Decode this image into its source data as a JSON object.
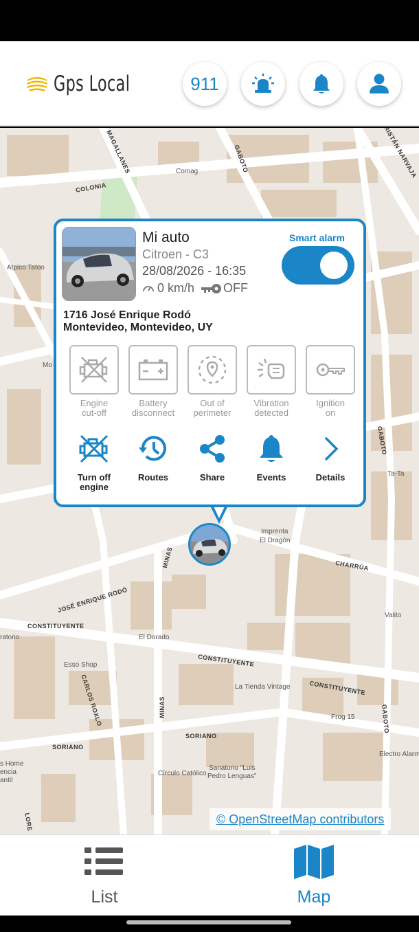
{
  "header": {
    "app_name": "Gps Local",
    "emergency_label": "911"
  },
  "popup": {
    "vehicle_name": "Mi auto",
    "vehicle_model": "Citroen - C3",
    "last_update": "28/08/2026 - 16:35",
    "speed": "0 km/h",
    "ignition_state": "OFF",
    "smart_alarm_label": "Smart alarm",
    "smart_alarm_on": true,
    "address_line1": "1716 José Enrique Rodó",
    "address_line2": "Montevideo,  Montevideo,  UY",
    "alerts": [
      {
        "line1": "Engine",
        "line2": "cut-off",
        "icon": "engine-cutoff-icon"
      },
      {
        "line1": "Battery",
        "line2": "disconnect",
        "icon": "battery-icon"
      },
      {
        "line1": "Out of",
        "line2": "perimeter",
        "icon": "perimeter-icon"
      },
      {
        "line1": "Vibration",
        "line2": "detected",
        "icon": "vibration-icon"
      },
      {
        "line1": "Ignition",
        "line2": "on",
        "icon": "key-icon"
      }
    ],
    "actions": [
      {
        "line1": "Turn off",
        "line2": "engine",
        "icon": "engine-off-icon"
      },
      {
        "line1": "Routes",
        "line2": "",
        "icon": "history-icon"
      },
      {
        "line1": "Share",
        "line2": "",
        "icon": "share-icon"
      },
      {
        "line1": "Events",
        "line2": "",
        "icon": "bell-icon"
      },
      {
        "line1": "Details",
        "line2": "",
        "icon": "chevron-right-icon"
      }
    ]
  },
  "map": {
    "attribution": "© OpenStreetMap contributors",
    "streets": [
      "COLONIA",
      "MAGALLANES",
      "GABOTO",
      "RISTÁN NARVAJA",
      "JOSÉ ENRIQUE RODÓ",
      "MINAS",
      "CHARRÚA",
      "CONSTITUYENTE",
      "CARLOS ROXLO",
      "SORIANO",
      "GABOTO",
      "LORE"
    ],
    "places": [
      "Comag",
      "Atpico Tatoo",
      "Imprenta",
      "El Dragón",
      "El Dorado",
      "Esso Shop",
      "La Tienda Vintage",
      "Frog 15",
      "Electro Alarma",
      "Valito",
      "Ta-Ta",
      "Círculo Católico",
      "Sanatorio \"Luis",
      "Pedro Lenguas\"",
      "ratorio",
      "s Home",
      "encia",
      "antil",
      "Mo"
    ]
  },
  "nav": {
    "list_label": "List",
    "map_label": "Map"
  },
  "colors": {
    "accent": "#1a86c7",
    "map_bg": "#ede9e2",
    "building": "#d9cbb8"
  }
}
